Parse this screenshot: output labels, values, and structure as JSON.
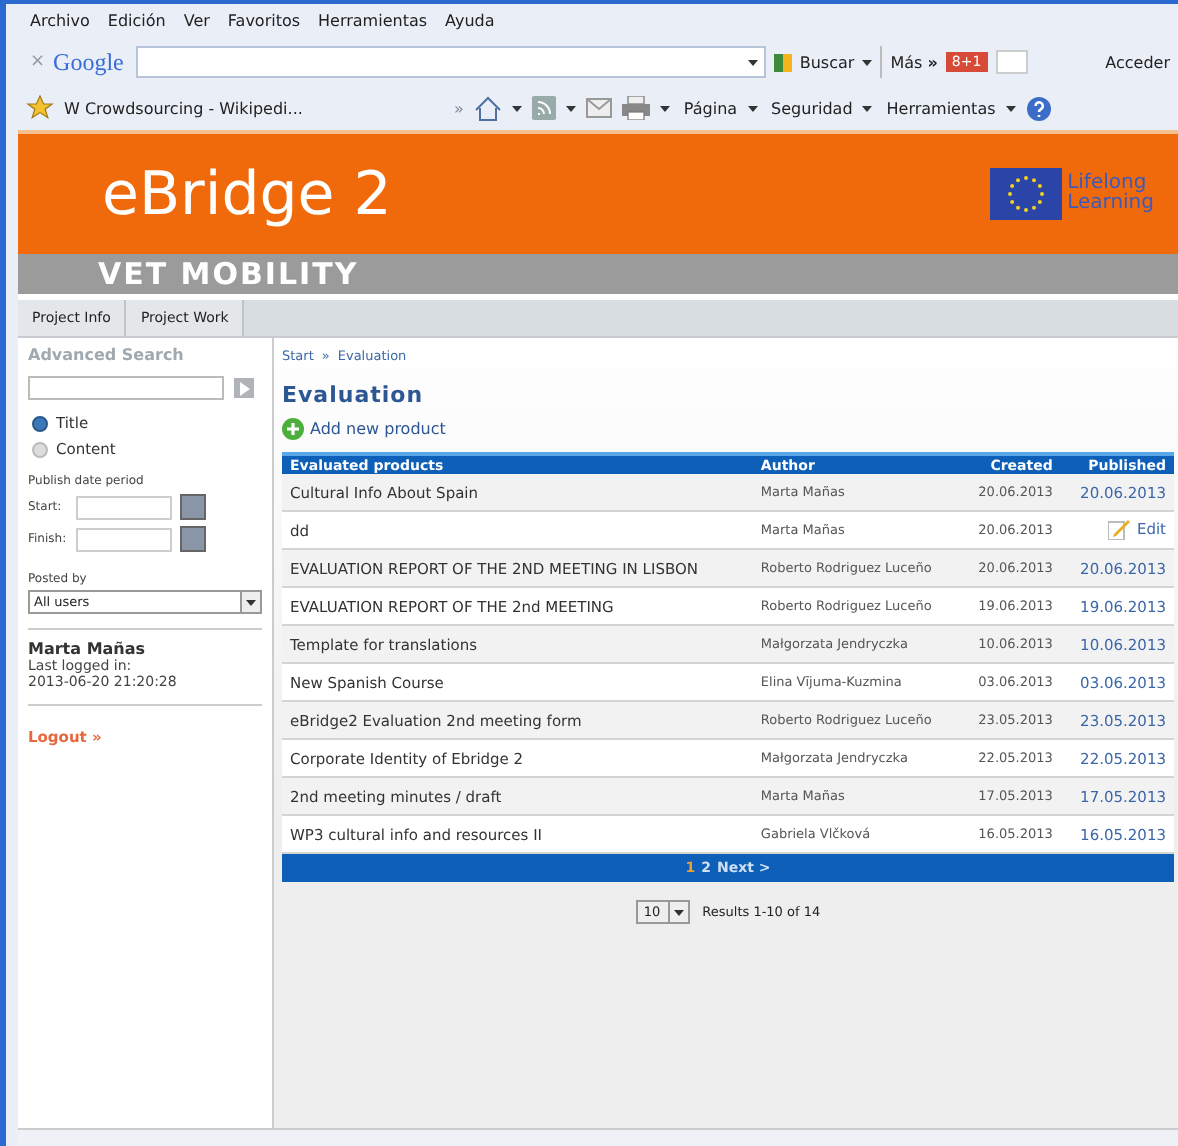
{
  "menu_bar": [
    "Archivo",
    "Edición",
    "Ver",
    "Favoritos",
    "Herramientas",
    "Ayuda"
  ],
  "google_toolbar": {
    "close": "×",
    "logo": "Google",
    "search_button": "Buscar",
    "more": "Más",
    "more_arrows": "»",
    "badge": "8+1",
    "sign_in": "Acceder"
  },
  "favorites_bar": {
    "tab": "W Crowdsourcing - Wikipedi...",
    "chevron": "»",
    "commands": [
      "Página",
      "Seguridad",
      "Herramientas"
    ]
  },
  "header": {
    "logo": "eBridge 2",
    "subtitle": "VET MOBILITY",
    "program_logo": [
      "Lifelong",
      "Learning"
    ]
  },
  "nav_tabs": [
    "Project Info",
    "Project Work"
  ],
  "sidebar": {
    "title": "Advanced Search",
    "search_scope": [
      {
        "label": "Title",
        "selected": true
      },
      {
        "label": "Content",
        "selected": false
      }
    ],
    "date_period_label": "Publish date period",
    "start_label": "Start:",
    "finish_label": "Finish:",
    "posted_by_label": "Posted by",
    "posted_by_value": "All users",
    "user_name": "Marta Mañas",
    "last_logged_label": "Last logged in:",
    "last_logged": "2013-06-20 21:20:28",
    "logout": "Logout »"
  },
  "breadcrumb": [
    "Start",
    "»",
    "Evaluation"
  ],
  "page_title": "Evaluation",
  "add_link": "Add new product",
  "table": {
    "columns": [
      "Evaluated products",
      "Author",
      "Created",
      "Published"
    ],
    "rows": [
      {
        "product": "Cultural Info About Spain",
        "author": "Marta Mañas",
        "created": "20.06.2013",
        "published": {
          "kind": "date",
          "text": "20.06.2013"
        }
      },
      {
        "product": "dd",
        "author": "Marta Mañas",
        "created": "20.06.2013",
        "published": {
          "kind": "edit",
          "text": "Edit"
        }
      },
      {
        "product": "EVALUATION REPORT OF THE 2ND MEETING IN LISBON",
        "author": "Roberto Rodriguez Luceño",
        "created": "20.06.2013",
        "published": {
          "kind": "date",
          "text": "20.06.2013"
        }
      },
      {
        "product": "EVALUATION REPORT OF THE 2nd MEETING",
        "author": "Roberto Rodriguez Luceño",
        "created": "19.06.2013",
        "published": {
          "kind": "date",
          "text": "19.06.2013"
        }
      },
      {
        "product": "Template for translations",
        "author": "Małgorzata Jendryczka",
        "created": "10.06.2013",
        "published": {
          "kind": "date",
          "text": "10.06.2013"
        }
      },
      {
        "product": "New Spanish Course",
        "author": "Elina Vījuma-Kuzmina",
        "created": "03.06.2013",
        "published": {
          "kind": "date",
          "text": "03.06.2013"
        }
      },
      {
        "product": "eBridge2 Evaluation 2nd meeting form",
        "author": "Roberto Rodriguez Luceño",
        "created": "23.05.2013",
        "published": {
          "kind": "date",
          "text": "23.05.2013"
        }
      },
      {
        "product": "Corporate Identity of Ebridge 2",
        "author": "Małgorzata Jendryczka",
        "created": "22.05.2013",
        "published": {
          "kind": "date",
          "text": "22.05.2013"
        }
      },
      {
        "product": "2nd meeting minutes / draft",
        "author": "Marta Mañas",
        "created": "17.05.2013",
        "published": {
          "kind": "date",
          "text": "17.05.2013"
        }
      },
      {
        "product": "WP3  cultural info and resources  II",
        "author": "Gabriela Vlčková",
        "created": "16.05.2013",
        "published": {
          "kind": "date",
          "text": "16.05.2013"
        }
      }
    ]
  },
  "pagination": [
    {
      "label": "1",
      "selected": true
    },
    {
      "label": "2",
      "selected": false
    },
    {
      "label": "Next >",
      "selected": false
    }
  ],
  "page_size": "10",
  "results": "Results 1-10 of 14"
}
